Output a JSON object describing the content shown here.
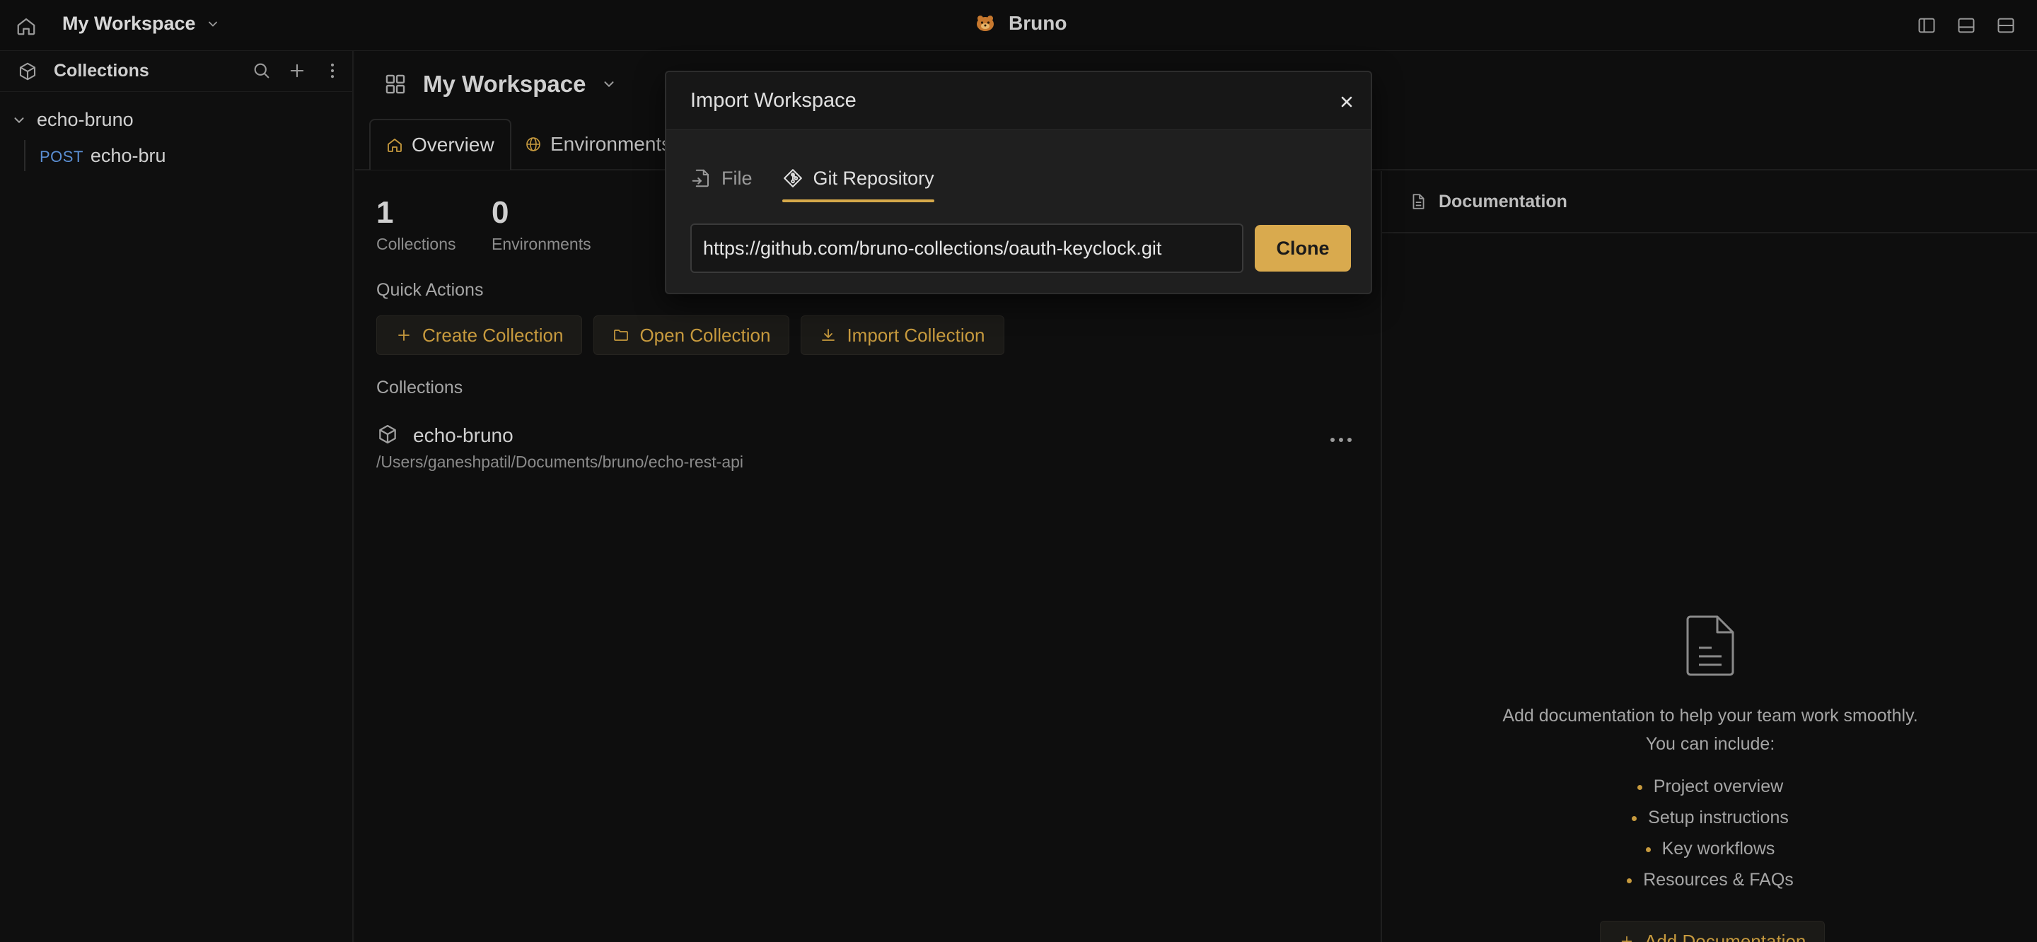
{
  "titlebar": {
    "workspace_name": "My Workspace",
    "app_name": "Bruno"
  },
  "sidebar": {
    "title": "Collections",
    "collection": {
      "name": "echo-bruno",
      "requests": [
        {
          "method": "POST",
          "name": "echo-bru"
        }
      ]
    }
  },
  "workspace": {
    "title": "My Workspace",
    "tabs": [
      {
        "label": "Overview"
      },
      {
        "label": "Environments"
      }
    ],
    "stats": [
      {
        "value": "1",
        "label": "Collections"
      },
      {
        "value": "0",
        "label": "Environments"
      }
    ],
    "quick_actions_title": "Quick Actions",
    "quick_actions": [
      {
        "label": "Create Collection",
        "icon": "plus-icon"
      },
      {
        "label": "Open Collection",
        "icon": "folder-icon"
      },
      {
        "label": "Import Collection",
        "icon": "download-icon"
      }
    ],
    "collections_title": "Collections",
    "collections": [
      {
        "name": "echo-bruno",
        "path": "/Users/ganeshpatil/Documents/bruno/echo-rest-api"
      }
    ]
  },
  "documentation": {
    "title": "Documentation",
    "empty_text_1": "Add documentation to help your team work smoothly.",
    "empty_text_2": "You can include:",
    "items": [
      "Project overview",
      "Setup instructions",
      "Key workflows",
      "Resources & FAQs"
    ],
    "add_button": "Add Documentation"
  },
  "modal": {
    "title": "Import Workspace",
    "tabs": [
      {
        "label": "File"
      },
      {
        "label": "Git Repository"
      }
    ],
    "active_tab": "Git Repository",
    "url_value": "https://github.com/bruno-collections/oauth-keyclock.git",
    "clone_label": "Clone"
  },
  "colors": {
    "accent": "#d9aa4e",
    "accent_text": "#c79a3e",
    "method_post": "#5b8fd4",
    "background": "#0f0f0f",
    "modal_bg": "#1f1f1f"
  }
}
